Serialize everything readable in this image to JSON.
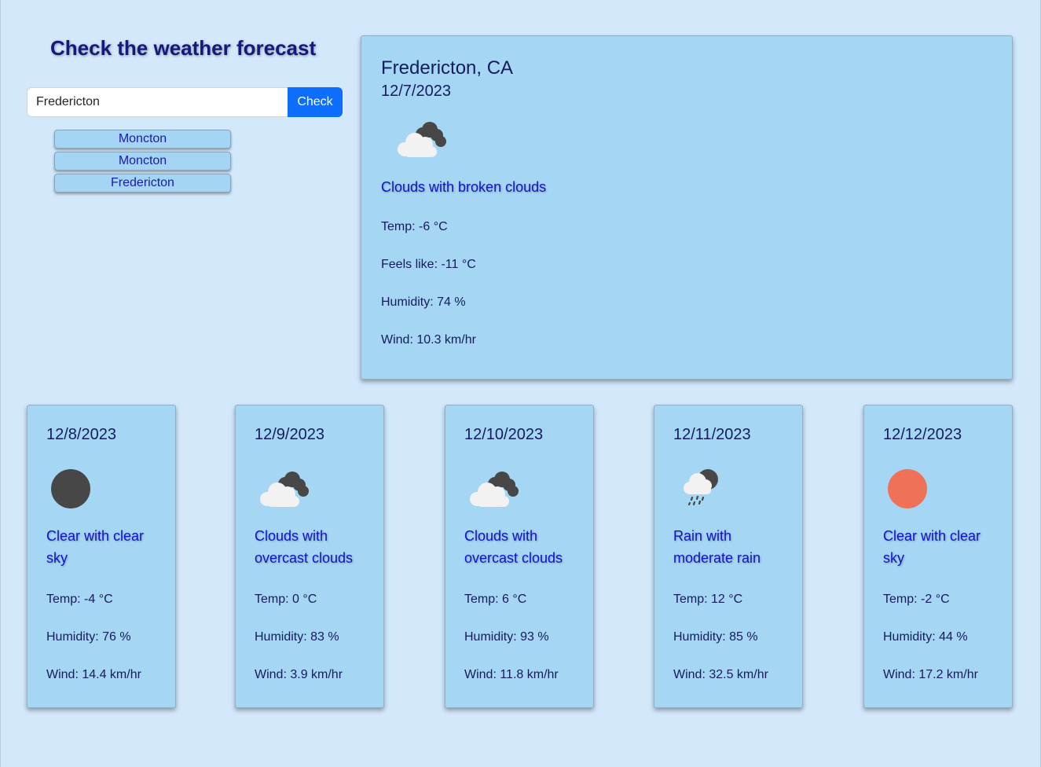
{
  "header": {
    "title": "Check the weather forecast"
  },
  "search": {
    "value": "Fredericton",
    "button_label": "Check"
  },
  "history": [
    "Moncton",
    "Moncton",
    "Fredericton"
  ],
  "current": {
    "city": "Fredericton, CA",
    "date": "12/7/2023",
    "icon": "broken-clouds-icon",
    "description": "Clouds with broken clouds",
    "temp": "Temp: -6 °C",
    "feels_like": "Feels like: -11 °C",
    "humidity": "Humidity: 74 %",
    "wind": "Wind: 10.3 km/hr"
  },
  "forecast": [
    {
      "date": "12/8/2023",
      "icon": "clear-night-icon",
      "description": "Clear with clear sky",
      "temp": "Temp: -4 °C",
      "humidity": "Humidity: 76 %",
      "wind": "Wind: 14.4 km/hr"
    },
    {
      "date": "12/9/2023",
      "icon": "overcast-clouds-icon",
      "description": "Clouds with overcast clouds",
      "temp": "Temp: 0 °C",
      "humidity": "Humidity: 83 %",
      "wind": "Wind: 3.9 km/hr"
    },
    {
      "date": "12/10/2023",
      "icon": "overcast-clouds-icon",
      "description": "Clouds with overcast clouds",
      "temp": "Temp: 6 °C",
      "humidity": "Humidity: 93 %",
      "wind": "Wind: 11.8 km/hr"
    },
    {
      "date": "12/11/2023",
      "icon": "rain-icon",
      "description": "Rain with moderate rain",
      "temp": "Temp: 12 °C",
      "humidity": "Humidity: 85 %",
      "wind": "Wind: 32.5 km/hr"
    },
    {
      "date": "12/12/2023",
      "icon": "clear-sun-icon",
      "description": "Clear with clear sky",
      "temp": "Temp: -2 °C",
      "humidity": "Humidity: 44 %",
      "wind": "Wind: 17.2 km/hr"
    }
  ],
  "colors": {
    "background": "#d3e8fb",
    "card": "#a5d6f4",
    "accent": "#0d6efd",
    "description": "#1212c9",
    "sun": "#ef7158",
    "moon": "#474747"
  }
}
